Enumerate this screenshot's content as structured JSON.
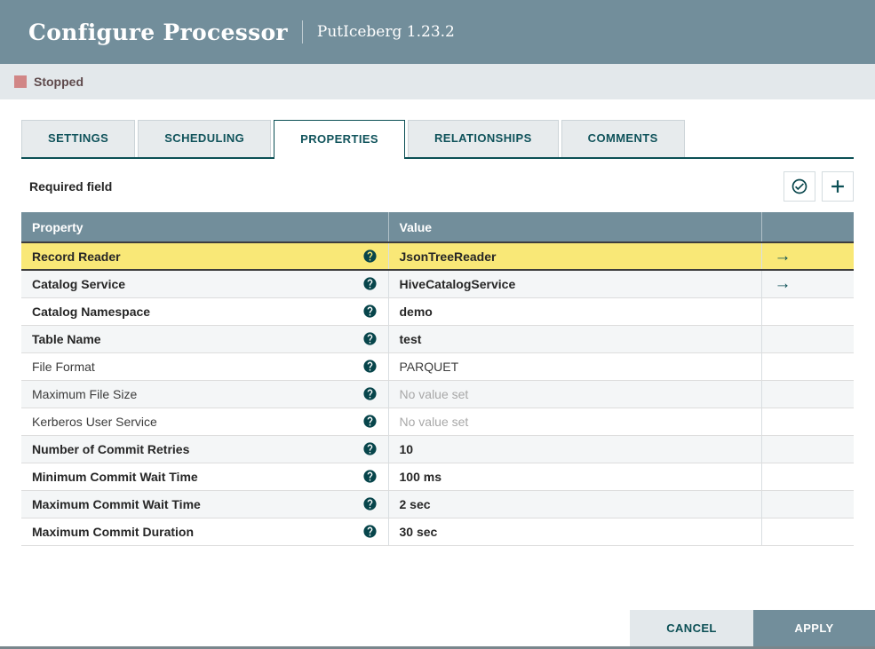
{
  "dialog": {
    "title": "Configure Processor",
    "subtitle": "PutIceberg 1.23.2"
  },
  "status": {
    "label": "Stopped"
  },
  "tabs": [
    {
      "label": "SETTINGS",
      "active": false
    },
    {
      "label": "SCHEDULING",
      "active": false
    },
    {
      "label": "PROPERTIES",
      "active": true
    },
    {
      "label": "RELATIONSHIPS",
      "active": false
    },
    {
      "label": "COMMENTS",
      "active": false
    }
  ],
  "properties_panel": {
    "required_label": "Required field",
    "toolbar": {
      "verify_icon": "check-circle",
      "add_icon": "plus"
    }
  },
  "table": {
    "columns": {
      "property": "Property",
      "value": "Value",
      "goto": ""
    },
    "rows": [
      {
        "property": "Record Reader",
        "value": "JsonTreeReader",
        "required": true,
        "unset": false,
        "goto": true,
        "highlighted": true
      },
      {
        "property": "Catalog Service",
        "value": "HiveCatalogService",
        "required": true,
        "unset": false,
        "goto": true,
        "highlighted": false
      },
      {
        "property": "Catalog Namespace",
        "value": "demo",
        "required": true,
        "unset": false,
        "goto": false,
        "highlighted": false
      },
      {
        "property": "Table Name",
        "value": "test",
        "required": true,
        "unset": false,
        "goto": false,
        "highlighted": false
      },
      {
        "property": "File Format",
        "value": "PARQUET",
        "required": false,
        "unset": false,
        "goto": false,
        "highlighted": false
      },
      {
        "property": "Maximum File Size",
        "value": "No value set",
        "required": false,
        "unset": true,
        "goto": false,
        "highlighted": false
      },
      {
        "property": "Kerberos User Service",
        "value": "No value set",
        "required": false,
        "unset": true,
        "goto": false,
        "highlighted": false
      },
      {
        "property": "Number of Commit Retries",
        "value": "10",
        "required": true,
        "unset": false,
        "goto": false,
        "highlighted": false
      },
      {
        "property": "Minimum Commit Wait Time",
        "value": "100 ms",
        "required": true,
        "unset": false,
        "goto": false,
        "highlighted": false
      },
      {
        "property": "Maximum Commit Wait Time",
        "value": "2 sec",
        "required": true,
        "unset": false,
        "goto": false,
        "highlighted": false
      },
      {
        "property": "Maximum Commit Duration",
        "value": "30 sec",
        "required": true,
        "unset": false,
        "goto": false,
        "highlighted": false
      }
    ]
  },
  "footer": {
    "cancel_label": "CANCEL",
    "apply_label": "APPLY"
  },
  "colors": {
    "header_bg": "#728e9b",
    "status_bar_bg": "#e3e8eb",
    "stopped_square": "#d18686",
    "accent_teal": "#0b4f55",
    "highlight_yellow": "#f9e877"
  }
}
